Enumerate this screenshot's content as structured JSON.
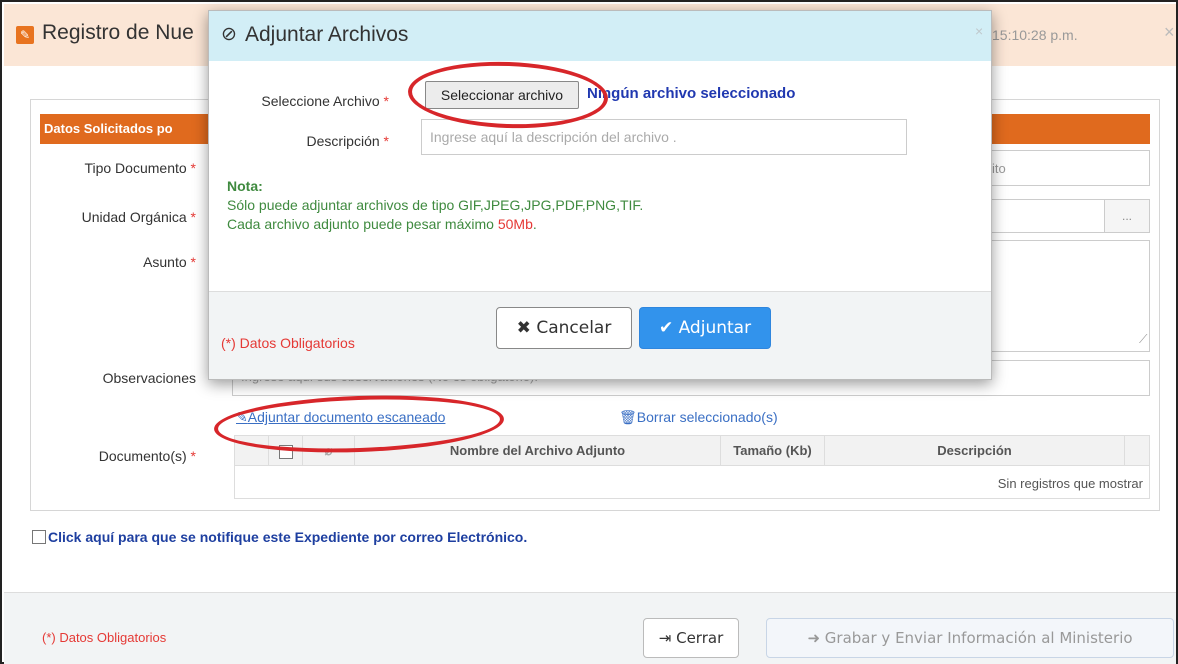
{
  "background": {
    "title": "Registro de Nue",
    "time": "15:10:28 p.m.",
    "close": "×",
    "section_title": "Datos Solicitados po",
    "labels": {
      "tipo_documento": "Tipo Documento",
      "unidad_organica": "Unidad Orgánica",
      "asunto": "Asunto",
      "observaciones": "Observaciones",
      "documentos": "Documento(s)"
    },
    "required_mark": "*",
    "tipo_documento_fragment": "ito",
    "dots_button": "...",
    "observaciones_placeholder": "Ingrese aquí sus observaciones (No es obligatorio).",
    "links": {
      "adjuntar": "Adjuntar documento escaneado",
      "borrar": "Borrar seleccionado(s)"
    },
    "table": {
      "headers": [
        "",
        "",
        "Nombre del Archivo Adjunto",
        "Tamaño (Kb)",
        "Descripción"
      ],
      "empty_message": "Sin registros que mostrar"
    },
    "notify_label": "Click aquí para que se notifique este Expediente por correo Electrónico.",
    "footer": {
      "required_note": "(*) Datos Obligatorios",
      "close_button": "Cerrar",
      "submit_button": "Grabar y Enviar Información al Ministerio"
    }
  },
  "dialog": {
    "title": "Adjuntar Archivos",
    "close": "×",
    "fields": {
      "file_label": "Seleccione Archivo",
      "file_button": "Seleccionar archivo",
      "file_status": "Ningún archivo seleccionado",
      "description_label": "Descripción",
      "description_placeholder": "Ingrese aquí la descripción del archivo ."
    },
    "note": {
      "title": "Nota:",
      "line1": "Sólo puede adjuntar archivos de tipo GIF,JPEG,JPG,PDF,PNG,TIF.",
      "line2_prefix": "Cada archivo adjunto puede pesar máximo ",
      "line2_size": "50Mb",
      "line2_suffix": "."
    },
    "footer": {
      "required_note": "(*) Datos Obligatorios",
      "cancel_button": "Cancelar",
      "attach_button": "Adjuntar"
    }
  },
  "colors": {
    "accent_orange": "#e06a1e",
    "primary_blue": "#3293ec",
    "required_red": "#e53935",
    "note_green": "#3f8a3f",
    "annotation_red": "#d7262a"
  },
  "icons": [
    "pencil-square-icon",
    "paperclip-icon",
    "close-icon",
    "trash-icon",
    "x-mark-icon",
    "checkmark-icon",
    "exit-icon",
    "arrow-circle-icon"
  ]
}
